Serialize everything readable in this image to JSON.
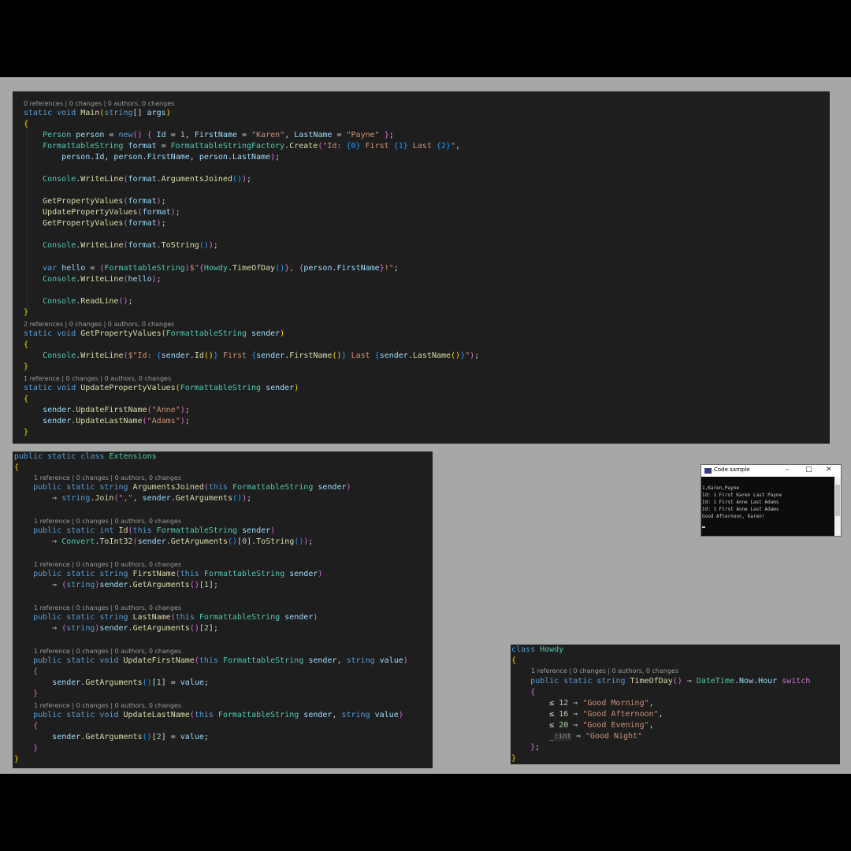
{
  "main_code": {
    "lens_main": "0 references | 0 changes | 0 authors, 0 changes",
    "lens_get": "2 references | 0 changes | 0 authors, 0 changes",
    "lens_update": "1 reference | 0 changes | 0 authors, 0 changes"
  },
  "extensions_code": {
    "lens_arguments_joined": "1 reference | 0 changes | 0 authors, 0 changes",
    "lens_id": "1 reference | 0 changes | 0 authors, 0 changes",
    "lens_first_name": "1 reference | 0 changes | 0 authors, 0 changes",
    "lens_last_name": "1 reference | 0 changes | 0 authors, 0 changes",
    "lens_update_first_name": "1 reference | 0 changes | 0 authors, 0 changes",
    "lens_update_last_name": "1 reference | 0 changes | 0 authors, 0 changes"
  },
  "howdy_code": {
    "lens_time_of_day": "1 reference | 0 changes | 0 authors, 0 changes",
    "inlay_hint": ":int"
  },
  "console_window": {
    "title": "Code sample",
    "minimize": "–",
    "maximize": "□",
    "close": "✕",
    "output_lines": [
      "1,Karen,Payne",
      "Id: 1 First Karen Last Payne",
      "Id: 1 First Anne Last Adams",
      "Id: 1 First Anne Last Adams",
      "Good Afternoon, Karen!"
    ]
  },
  "colors": {
    "editor_background": "#1e1e1e",
    "page_background": "#a6a8a5",
    "keyword": "#569cd6",
    "type": "#4ec9b0",
    "method": "#dcdcaa",
    "string": "#ce9178",
    "number": "#b5cea8"
  }
}
